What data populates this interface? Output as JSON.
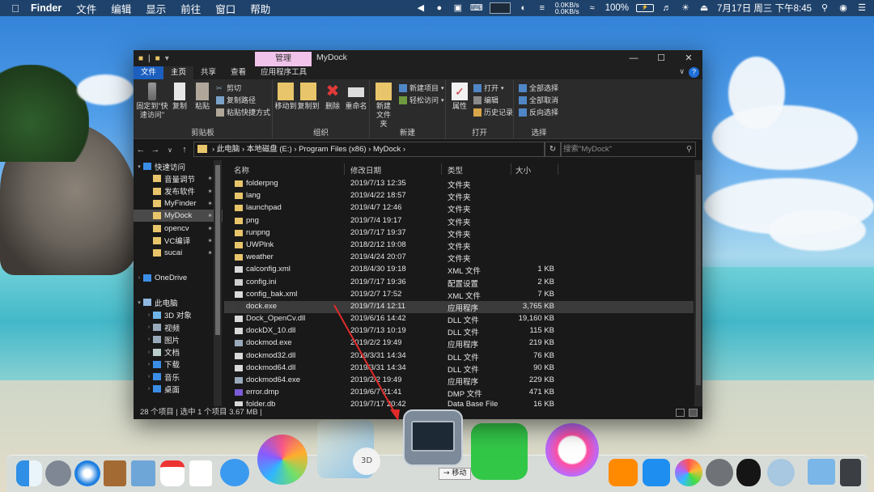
{
  "menubar": {
    "app": "Finder",
    "menus": [
      "文件",
      "编辑",
      "显示",
      "前往",
      "窗口",
      "帮助"
    ],
    "net_up": "0.0KB/s",
    "net_down": "0.0KB/s",
    "battery": "100%",
    "datetime": "7月17日 周三 下午8:45"
  },
  "window": {
    "context_tab": "管理",
    "title": "MyDock",
    "tabs": [
      "文件",
      "主页",
      "共享",
      "查看",
      "应用程序工具"
    ],
    "ribbon": {
      "clipboard": {
        "pin": "固定到\"快速访问\"",
        "copy": "复制",
        "paste": "粘贴",
        "cut": "剪切",
        "copy_path": "复制路径",
        "paste_shortcut": "粘贴快捷方式",
        "group": "剪贴板"
      },
      "organize": {
        "move_to": "移动到",
        "copy_to": "复制到",
        "delete": "删除",
        "rename": "重命名",
        "group": "组织"
      },
      "new": {
        "new_folder": "新建\n文件夹",
        "new_item": "新建项目",
        "easy_access": "轻松访问",
        "group": "新建"
      },
      "open": {
        "properties": "属性",
        "open": "打开",
        "edit": "编辑",
        "history": "历史记录",
        "group": "打开"
      },
      "select": {
        "select_all": "全部选择",
        "select_none": "全部取消",
        "invert": "反向选择",
        "group": "选择"
      }
    },
    "address": {
      "path": "›  此电脑  ›  本地磁盘 (E:)  ›  Program Files (x86)  ›  MyDock  ›",
      "search_placeholder": "搜索\"MyDock\""
    },
    "nav": [
      {
        "label": "快速访问",
        "level": 0,
        "arrow": "v",
        "color": "#3a8ee6"
      },
      {
        "label": "音量调节",
        "level": 1,
        "pin": true,
        "color": "#e8c56a"
      },
      {
        "label": "发布软件",
        "level": 1,
        "pin": true,
        "color": "#e8c56a"
      },
      {
        "label": "MyFinder",
        "level": 1,
        "pin": true,
        "color": "#e8c56a"
      },
      {
        "label": "MyDock",
        "level": 1,
        "pin": true,
        "selected": true,
        "color": "#e8c56a"
      },
      {
        "label": "opencv",
        "level": 1,
        "pin": true,
        "color": "#e8c56a"
      },
      {
        "label": "VC编译",
        "level": 1,
        "pin": true,
        "color": "#e8c56a"
      },
      {
        "label": "sucai",
        "level": 1,
        "pin": true,
        "color": "#e8c56a"
      },
      {
        "label": "",
        "level": 1,
        "color": ""
      },
      {
        "label": "OneDrive",
        "level": 0,
        "arrow": ">",
        "color": "#3a8ee6"
      },
      {
        "label": "",
        "level": 1,
        "color": ""
      },
      {
        "label": "此电脑",
        "level": 0,
        "arrow": "v",
        "color": "#8fb8e0"
      },
      {
        "label": "3D 对象",
        "level": 1,
        "arrow": ">",
        "color": "#6fb6e8"
      },
      {
        "label": "视频",
        "level": 1,
        "arrow": ">",
        "color": "#9ab"
      },
      {
        "label": "图片",
        "level": 1,
        "arrow": ">",
        "color": "#9ab"
      },
      {
        "label": "文档",
        "level": 1,
        "arrow": ">",
        "color": "#bcc"
      },
      {
        "label": "下载",
        "level": 1,
        "arrow": ">",
        "color": "#3a8ee6"
      },
      {
        "label": "音乐",
        "level": 1,
        "arrow": ">",
        "color": "#3a8ee6"
      },
      {
        "label": "桌面",
        "level": 1,
        "arrow": ">",
        "color": "#3a8ee6"
      }
    ],
    "columns": [
      "名称",
      "修改日期",
      "类型",
      "大小"
    ],
    "files": [
      {
        "name": "folderpng",
        "date": "2019/7/13 12:35",
        "type": "文件夹",
        "size": "",
        "kind": "folder"
      },
      {
        "name": "lang",
        "date": "2019/4/22 18:57",
        "type": "文件夹",
        "size": "",
        "kind": "folder"
      },
      {
        "name": "launchpad",
        "date": "2019/4/7 12:46",
        "type": "文件夹",
        "size": "",
        "kind": "folder"
      },
      {
        "name": "png",
        "date": "2019/7/4 19:17",
        "type": "文件夹",
        "size": "",
        "kind": "folder"
      },
      {
        "name": "runpng",
        "date": "2019/7/17 19:37",
        "type": "文件夹",
        "size": "",
        "kind": "folder"
      },
      {
        "name": "UWPlnk",
        "date": "2018/2/12 19:08",
        "type": "文件夹",
        "size": "",
        "kind": "folder"
      },
      {
        "name": "weather",
        "date": "2019/4/24 20:07",
        "type": "文件夹",
        "size": "",
        "kind": "folder"
      },
      {
        "name": "calconfig.xml",
        "date": "2018/4/30 19:18",
        "type": "XML 文件",
        "size": "1 KB",
        "kind": "xml"
      },
      {
        "name": "config.ini",
        "date": "2019/7/17 19:36",
        "type": "配置设置",
        "size": "2 KB",
        "kind": "ini"
      },
      {
        "name": "config_bak.xml",
        "date": "2019/2/7 17:52",
        "type": "XML 文件",
        "size": "7 KB",
        "kind": "xml"
      },
      {
        "name": "dock.exe",
        "date": "2019/7/14 12:11",
        "type": "应用程序",
        "size": "3,765 KB",
        "kind": "exe",
        "selected": true
      },
      {
        "name": "Dock_OpenCv.dll",
        "date": "2019/6/16 14:42",
        "type": "DLL 文件",
        "size": "19,160 KB",
        "kind": "dll"
      },
      {
        "name": "dockDX_10.dll",
        "date": "2019/7/13 10:19",
        "type": "DLL 文件",
        "size": "115 KB",
        "kind": "dll"
      },
      {
        "name": "dockmod.exe",
        "date": "2019/2/2 19:49",
        "type": "应用程序",
        "size": "219 KB",
        "kind": "exe2"
      },
      {
        "name": "dockmod32.dll",
        "date": "2019/3/31 14:34",
        "type": "DLL 文件",
        "size": "76 KB",
        "kind": "dll"
      },
      {
        "name": "dockmod64.dll",
        "date": "2019/3/31 14:34",
        "type": "DLL 文件",
        "size": "90 KB",
        "kind": "dll"
      },
      {
        "name": "dockmod64.exe",
        "date": "2019/2/2 19:49",
        "type": "应用程序",
        "size": "229 KB",
        "kind": "exe2"
      },
      {
        "name": "error.dmp",
        "date": "2019/6/7 21:41",
        "type": "DMP 文件",
        "size": "471 KB",
        "kind": "dmp"
      },
      {
        "name": "folder.db",
        "date": "2019/7/17 20:42",
        "type": "Data Base File",
        "size": "16 KB",
        "kind": "db"
      }
    ],
    "status": "28 个项目  |  选中 1 个项目  3.67 MB  |"
  },
  "dock": {
    "tooltip": "→ 移动",
    "maps_label": "3D"
  }
}
